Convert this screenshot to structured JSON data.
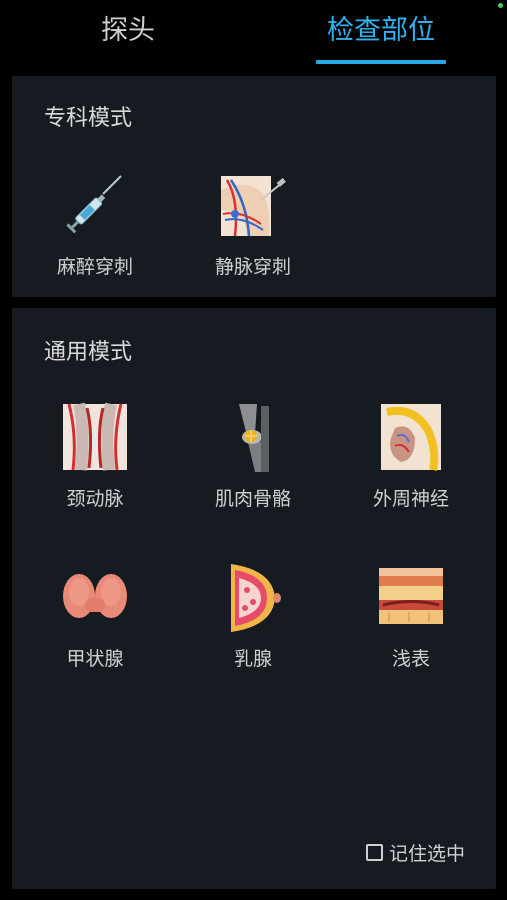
{
  "tabs": [
    {
      "label": "探头",
      "active": false
    },
    {
      "label": "检查部位",
      "active": true
    }
  ],
  "accent_color": "#2fb3f0",
  "special_mode": {
    "title": "专科模式",
    "items": [
      {
        "label": "麻醉穿刺",
        "icon": "syringe-icon"
      },
      {
        "label": "静脉穿刺",
        "icon": "shoulder-vein-icon"
      }
    ]
  },
  "general_mode": {
    "title": "通用模式",
    "items": [
      {
        "label": "颈动脉",
        "icon": "carotid-artery-icon"
      },
      {
        "label": "肌肉骨骼",
        "icon": "knee-joint-icon"
      },
      {
        "label": "外周神经",
        "icon": "peripheral-nerve-icon"
      },
      {
        "label": "甲状腺",
        "icon": "thyroid-icon"
      },
      {
        "label": "乳腺",
        "icon": "breast-icon"
      },
      {
        "label": "浅表",
        "icon": "skin-layers-icon"
      }
    ]
  },
  "remember_selection": {
    "label": "记住选中",
    "checked": false
  }
}
